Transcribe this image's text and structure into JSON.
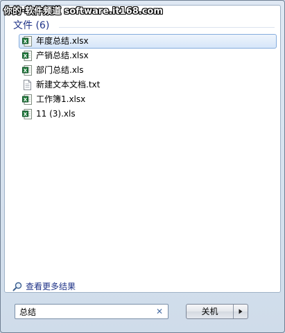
{
  "watermark": {
    "text": "你的·软件频道 software.it168.com"
  },
  "results": {
    "section_title": "文件 (6)",
    "items": [
      {
        "name": "年度总结.xlsx",
        "icon": "excel-icon",
        "selected": true
      },
      {
        "name": "产销总结.xlsx",
        "icon": "excel-icon",
        "selected": false
      },
      {
        "name": "部门总结.xls",
        "icon": "excel-icon",
        "selected": false
      },
      {
        "name": "新建文本文档.txt",
        "icon": "text-file-icon",
        "selected": false
      },
      {
        "name": "工作簿1.xlsx",
        "icon": "excel-icon",
        "selected": false
      },
      {
        "name": "11 (3).xls",
        "icon": "excel-icon",
        "selected": false
      }
    ],
    "see_more_label": "查看更多结果"
  },
  "search": {
    "value": "总结",
    "clear_symbol": "✕"
  },
  "shutdown": {
    "label": "关机",
    "arrow_symbol": "▶"
  },
  "colors": {
    "link_blue": "#1e3287",
    "selection_border": "#84acdd",
    "excel_green": "#1f7a3a"
  }
}
